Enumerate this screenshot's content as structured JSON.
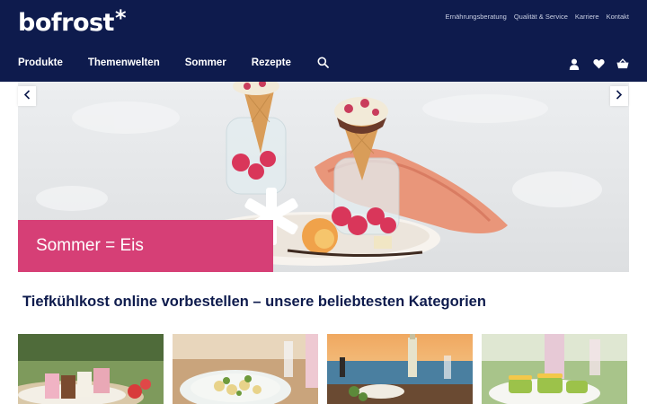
{
  "brand": {
    "logo_text": "bofrost",
    "logo_star": "*"
  },
  "meta_nav": [
    "Ernährungsberatung",
    "Qualität & Service",
    "Karriere",
    "Kontakt"
  ],
  "main_nav": [
    "Produkte",
    "Themenwelten",
    "Sommer",
    "Rezepte"
  ],
  "icons": {
    "search": "search-icon",
    "account": "user-icon",
    "wishlist": "heart-icon",
    "cart": "basket-icon",
    "prev": "chevron-left-icon",
    "next": "chevron-right-icon"
  },
  "hero": {
    "banner_text": "Sommer = Eis"
  },
  "section": {
    "title": "Tiefkühlkost online vorbestellen – unsere beliebtesten Kategorien"
  },
  "colors": {
    "navy": "#0e1b4d",
    "pink": "#d63f76",
    "white": "#ffffff"
  }
}
